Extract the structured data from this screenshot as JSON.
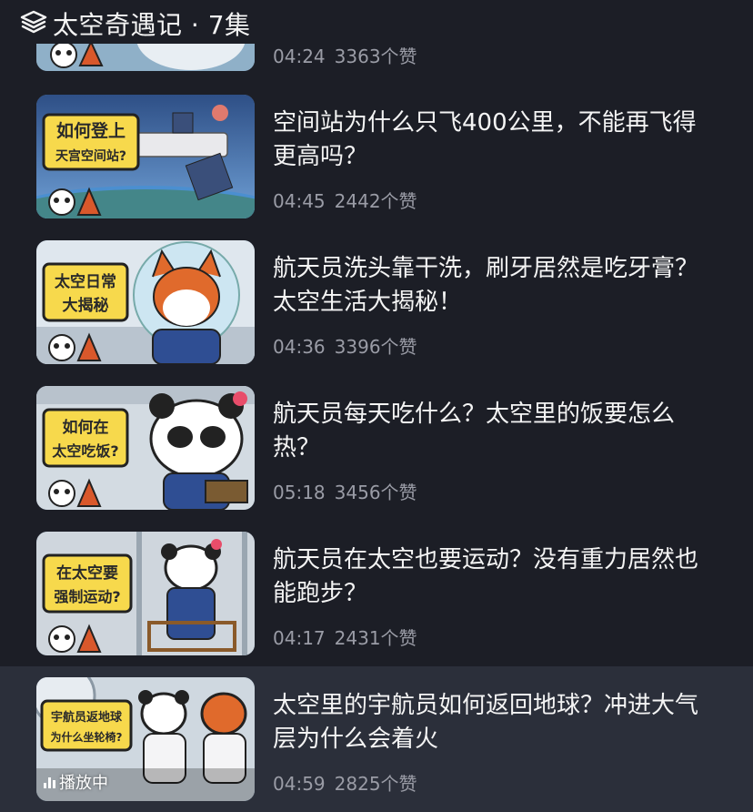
{
  "header": {
    "title": "太空奇遇记 · 7集"
  },
  "episodes": [
    {
      "title": "",
      "duration": "04:24",
      "likes": "3363个赞",
      "thumb_text": [
        "",
        ""
      ]
    },
    {
      "title": "空间站为什么只飞400公里，不能再飞得更高吗？",
      "duration": "04:45",
      "likes": "2442个赞",
      "thumb_text": [
        "如何登上",
        "天宫空间站?"
      ]
    },
    {
      "title": "航天员洗头靠干洗，刷牙居然是吃牙膏？太空生活大揭秘！",
      "duration": "04:36",
      "likes": "3396个赞",
      "thumb_text": [
        "太空日常",
        "大揭秘"
      ]
    },
    {
      "title": "航天员每天吃什么？太空里的饭要怎么热？",
      "duration": "05:18",
      "likes": "3456个赞",
      "thumb_text": [
        "如何在",
        "太空吃饭?"
      ]
    },
    {
      "title": "航天员在太空也要运动？没有重力居然也能跑步？",
      "duration": "04:17",
      "likes": "2431个赞",
      "thumb_text": [
        "在太空要",
        "强制运动?"
      ]
    },
    {
      "title": "太空里的宇航员如何返回地球？冲进大气层为什么会着火",
      "duration": "04:59",
      "likes": "2825个赞",
      "thumb_text": [
        "宇航员返地球",
        "为什么坐轮椅?"
      ],
      "playing_label": "播放中"
    }
  ],
  "colors": {
    "background": "#1c1e26",
    "playing_row": "#2b2f3a",
    "meta": "#9a9ca6",
    "sign_yellow": "#f7d94c"
  },
  "icons": {
    "header": "layers-icon",
    "playing": "equalizer-icon"
  }
}
